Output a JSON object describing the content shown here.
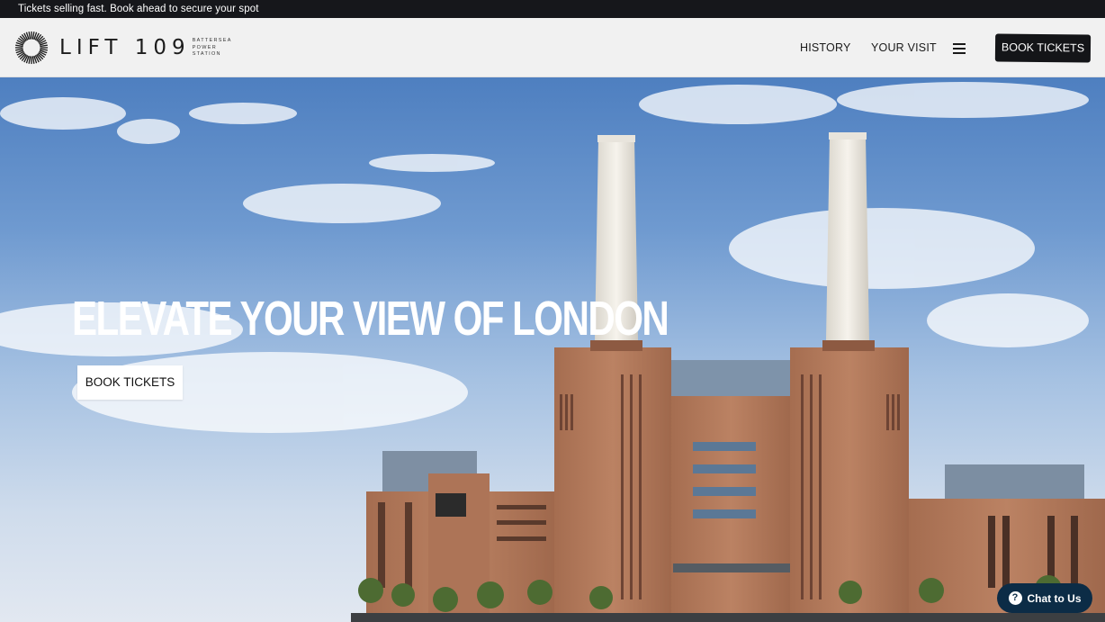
{
  "announcement": "Tickets selling fast. Book ahead to secure your spot",
  "header": {
    "logo_word": "LIFT 109",
    "logo_sub": [
      "BATTERSEA",
      "POWER",
      "STATION"
    ],
    "nav": [
      "HISTORY",
      "YOUR VISIT"
    ],
    "book_label": "BOOK TICKETS"
  },
  "hero": {
    "title": "ELEVATE YOUR VIEW OF LONDON",
    "cta_label": "BOOK TICKETS"
  },
  "chat": {
    "label": "Chat to Us",
    "icon_glyph": "?"
  },
  "colors": {
    "announcement_bg": "#16171b",
    "header_bg": "#f1f1f1",
    "primary_button": "#141518",
    "chat_button": "#0c2c46",
    "brick": "#b37a5a"
  },
  "icons": [
    "sunburst-logo-icon",
    "hamburger-menu-icon",
    "question-chat-icon"
  ]
}
